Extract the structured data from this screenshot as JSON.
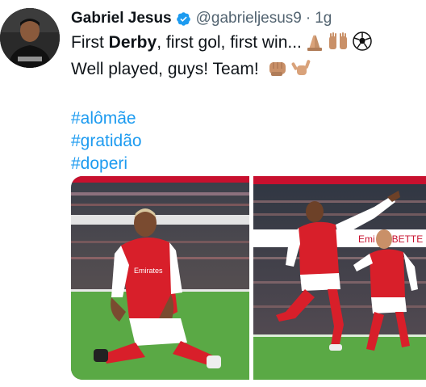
{
  "tweet": {
    "author": {
      "display_name": "Gabriel Jesus",
      "handle": "@gabrieljesus9",
      "verified": true,
      "avatar_icon": "profile-photo"
    },
    "separator": "·",
    "timestamp": "1g",
    "text": {
      "line1": {
        "prefix": "First ",
        "bold": "Derby",
        "suffix": ", first gol, first win...",
        "emojis": [
          "folded-hands-emoji",
          "raised-hands-emoji",
          "soccer-ball-emoji"
        ]
      },
      "line2": {
        "text": "Well played, guys! Team!",
        "emojis": [
          "fist-bump-emoji",
          "call-me-hand-emoji"
        ]
      }
    },
    "hashtags": [
      "#alômãe",
      "#gratidão",
      "#doperi"
    ],
    "media": [
      {
        "name": "photo-kneeling-celebration",
        "jersey_text": "Emirates"
      },
      {
        "name": "photo-running-celebration",
        "ad_board_text": "Emi  AY BETTE"
      }
    ],
    "colors": {
      "link": "#1d9bf0",
      "secondary_text": "#536471",
      "arsenal_red": "#d81f2a",
      "pitch_green": "#5aa945"
    }
  }
}
